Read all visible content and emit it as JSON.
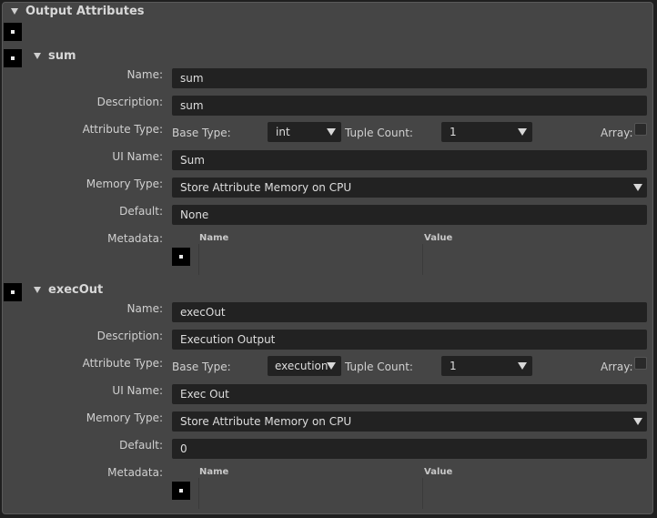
{
  "panel": {
    "title": "Output Attributes"
  },
  "attributes": [
    {
      "header": "sum",
      "labels": {
        "name": "Name:",
        "description": "Description:",
        "attribute_type": "Attribute Type:",
        "ui_name": "UI Name:",
        "memory_type": "Memory Type:",
        "default": "Default:",
        "metadata": "Metadata:"
      },
      "name": "sum",
      "description": "sum",
      "base_type_label": "Base Type:",
      "base_type": "int",
      "tuple_count_label": "Tuple Count:",
      "tuple_count": "1",
      "array_label": "Array:",
      "ui_name": "Sum",
      "memory_type": "Store Attribute Memory on CPU",
      "default": "None",
      "metadata_columns": [
        "Name",
        "Value"
      ]
    },
    {
      "header": "execOut",
      "labels": {
        "name": "Name:",
        "description": "Description:",
        "attribute_type": "Attribute Type:",
        "ui_name": "UI Name:",
        "memory_type": "Memory Type:",
        "default": "Default:",
        "metadata": "Metadata:"
      },
      "name": "execOut",
      "description": "Execution Output",
      "base_type_label": "Base Type:",
      "base_type": "execution",
      "tuple_count_label": "Tuple Count:",
      "tuple_count": "1",
      "array_label": "Array:",
      "ui_name": "Exec Out",
      "memory_type": "Store Attribute Memory on CPU",
      "default": "0",
      "metadata_columns": [
        "Name",
        "Value"
      ]
    }
  ]
}
